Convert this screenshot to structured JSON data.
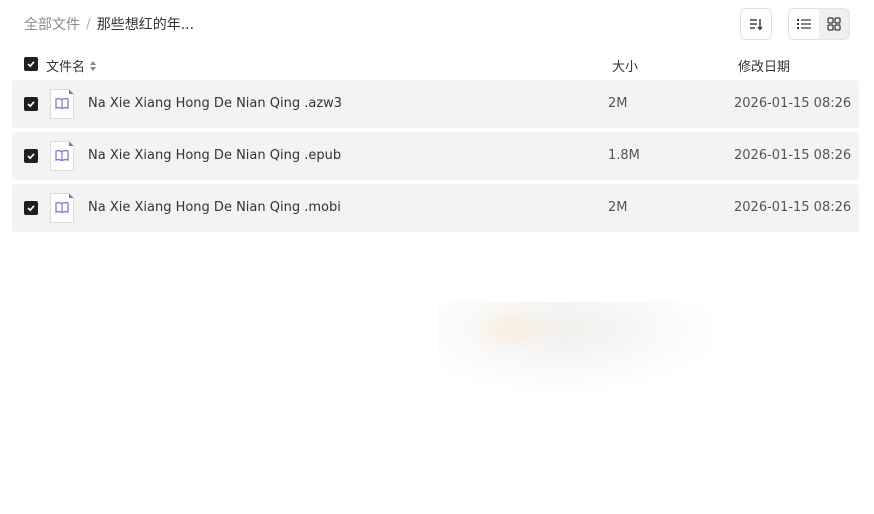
{
  "breadcrumb": {
    "root": "全部文件",
    "separator": "/",
    "current": "那些想红的年..."
  },
  "toolbar": {
    "sort_icon": "sort-icon",
    "list_view_icon": "list-view-icon",
    "grid_view_icon": "grid-view-icon",
    "active_view": "grid"
  },
  "table": {
    "headers": {
      "name": "文件名",
      "size": "大小",
      "date": "修改日期"
    },
    "rows": [
      {
        "name": "Na Xie Xiang Hong De Nian Qing .azw3",
        "size": "2M",
        "date": "2026-01-15 08:26",
        "checked": true,
        "icon": "ebook-icon"
      },
      {
        "name": "Na Xie Xiang Hong De Nian Qing .epub",
        "size": "1.8M",
        "date": "2026-01-15 08:26",
        "checked": true,
        "icon": "ebook-icon"
      },
      {
        "name": "Na Xie Xiang Hong De Nian Qing .mobi",
        "size": "2M",
        "date": "2026-01-15 08:26",
        "checked": true,
        "icon": "ebook-icon"
      }
    ]
  },
  "colors": {
    "row_bg": "#f3f3f3",
    "checkbox": "#1f1f1f",
    "icon_accent": "#7b6fd6"
  }
}
